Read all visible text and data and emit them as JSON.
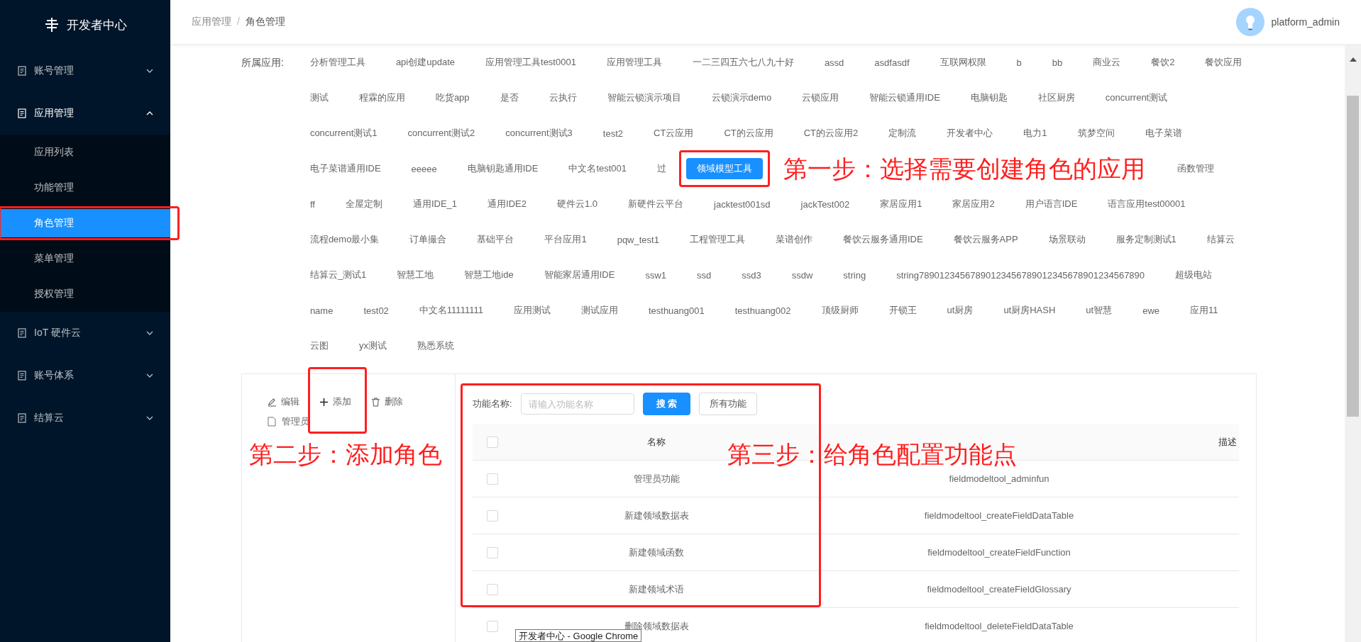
{
  "sidebar": {
    "logo": "开发者中心",
    "items": [
      {
        "label": "账号管理",
        "expanded": false
      },
      {
        "label": "应用管理",
        "expanded": true,
        "children": [
          {
            "label": "应用列表",
            "selected": false,
            "highlighted": false
          },
          {
            "label": "功能管理",
            "selected": false,
            "highlighted": false
          },
          {
            "label": "角色管理",
            "selected": true,
            "highlighted": true
          },
          {
            "label": "菜单管理",
            "selected": false,
            "highlighted": false
          },
          {
            "label": "授权管理",
            "selected": false,
            "highlighted": false
          }
        ]
      },
      {
        "label": "IoT 硬件云",
        "expanded": false
      },
      {
        "label": "账号体系",
        "expanded": false
      },
      {
        "label": "结算云",
        "expanded": false
      }
    ]
  },
  "header": {
    "breadcrumb": [
      "应用管理",
      "角色管理"
    ],
    "separator": "/",
    "user": "platform_admin"
  },
  "apps": {
    "label": "所属应用:",
    "tags": [
      {
        "label": "分析管理工具",
        "selected": false
      },
      {
        "label": "api创建update",
        "selected": false
      },
      {
        "label": "应用管理工具test0001",
        "selected": false
      },
      {
        "label": "应用管理工具",
        "selected": false
      },
      {
        "label": "一二三四五六七八九十好",
        "selected": false
      },
      {
        "label": "assd",
        "selected": false
      },
      {
        "label": "asdfasdf",
        "selected": false
      },
      {
        "label": "互联网权限",
        "selected": false
      },
      {
        "label": "b",
        "selected": false
      },
      {
        "label": "bb",
        "selected": false
      },
      {
        "label": "商业云",
        "selected": false
      },
      {
        "label": "餐饮2",
        "selected": false
      },
      {
        "label": "餐饮应用",
        "selected": false
      },
      {
        "label": "测试",
        "selected": false
      },
      {
        "label": "程霖的应用",
        "selected": false
      },
      {
        "label": "吃货app",
        "selected": false
      },
      {
        "label": "是否",
        "selected": false
      },
      {
        "label": "云执行",
        "selected": false
      },
      {
        "label": "智能云锁演示项目",
        "selected": false
      },
      {
        "label": "云锁演示demo",
        "selected": false
      },
      {
        "label": "云锁应用",
        "selected": false
      },
      {
        "label": "智能云锁通用IDE",
        "selected": false
      },
      {
        "label": "电脑钥匙",
        "selected": false
      },
      {
        "label": "社区厨房",
        "selected": false
      },
      {
        "label": "concurrent测试",
        "selected": false
      },
      {
        "label": "concurrent测试1",
        "selected": false
      },
      {
        "label": "concurrent测试2",
        "selected": false
      },
      {
        "label": "concurrent测试3",
        "selected": false
      },
      {
        "label": "test2",
        "selected": false
      },
      {
        "label": "CT云应用",
        "selected": false
      },
      {
        "label": "CT的云应用",
        "selected": false
      },
      {
        "label": "CT的云应用2",
        "selected": false
      },
      {
        "label": "定制流",
        "selected": false
      },
      {
        "label": "开发者中心",
        "selected": false
      },
      {
        "label": "电力1",
        "selected": false
      },
      {
        "label": "筑梦空间",
        "selected": false
      },
      {
        "label": "电子菜谱",
        "selected": false
      },
      {
        "label": "电子菜谱通用IDE",
        "selected": false
      },
      {
        "label": "eeeee",
        "selected": false
      },
      {
        "label": "电脑钥匙通用IDE",
        "selected": false
      },
      {
        "label": "中文名test001",
        "selected": false
      },
      {
        "label": "过",
        "selected": false
      },
      {
        "label": "领域模型工具",
        "selected": true
      },
      {
        "note": "第一步：选择需要创建角色的应用"
      },
      {
        "label": "函数管理",
        "selected": false
      },
      {
        "label": "ff",
        "selected": false
      },
      {
        "label": "全屋定制",
        "selected": false
      },
      {
        "label": "通用IDE_1",
        "selected": false
      },
      {
        "label": "通用IDE2",
        "selected": false
      },
      {
        "label": "硬件云1.0",
        "selected": false
      },
      {
        "label": "新硬件云平台",
        "selected": false
      },
      {
        "label": "jacktest001sd",
        "selected": false
      },
      {
        "label": "jackTest002",
        "selected": false
      },
      {
        "label": "家居应用1",
        "selected": false
      },
      {
        "label": "家居应用2",
        "selected": false
      },
      {
        "label": "用户语言IDE",
        "selected": false
      },
      {
        "label": "语言应用test00001",
        "selected": false
      },
      {
        "label": "流程demo最小集",
        "selected": false
      },
      {
        "label": "订单撮合",
        "selected": false
      },
      {
        "label": "基础平台",
        "selected": false
      },
      {
        "label": "平台应用1",
        "selected": false
      },
      {
        "label": "pqw_test1",
        "selected": false
      },
      {
        "label": "工程管理工具",
        "selected": false
      },
      {
        "label": "菜谱创作",
        "selected": false
      },
      {
        "label": "餐饮云服务通用IDE",
        "selected": false
      },
      {
        "label": "餐饮云服务APP",
        "selected": false
      },
      {
        "label": "场景联动",
        "selected": false
      },
      {
        "label": "服务定制测试1",
        "selected": false
      },
      {
        "label": "结算云",
        "selected": false
      },
      {
        "label": "结算云_测试1",
        "selected": false
      },
      {
        "label": "智慧工地",
        "selected": false
      },
      {
        "label": "智慧工地ide",
        "selected": false
      },
      {
        "label": "智能家居通用IDE",
        "selected": false
      },
      {
        "label": "ssw1",
        "selected": false
      },
      {
        "label": "ssd",
        "selected": false
      },
      {
        "label": "ssd3",
        "selected": false
      },
      {
        "label": "ssdw",
        "selected": false
      },
      {
        "label": "string",
        "selected": false
      },
      {
        "label": "string78901234567890123456789012345678901234567890",
        "selected": false
      },
      {
        "label": "超级电站",
        "selected": false
      },
      {
        "label": "name",
        "selected": false
      },
      {
        "label": "test02",
        "selected": false
      },
      {
        "label": "中文名11111111",
        "selected": false
      },
      {
        "label": "应用测试",
        "selected": false
      },
      {
        "label": "测试应用",
        "selected": false
      },
      {
        "label": "testhuang001",
        "selected": false
      },
      {
        "label": "testhuang002",
        "selected": false
      },
      {
        "label": "顶级厨师",
        "selected": false
      },
      {
        "label": "开锁王",
        "selected": false
      },
      {
        "label": "ut厨房",
        "selected": false
      },
      {
        "label": "ut厨房HASH",
        "selected": false
      },
      {
        "label": "ut智慧",
        "selected": false
      },
      {
        "label": "ewe",
        "selected": false
      },
      {
        "label": "应用11",
        "selected": false
      },
      {
        "label": "云图",
        "selected": false
      },
      {
        "label": "yx测试",
        "selected": false
      },
      {
        "label": "熟悉系统",
        "selected": false
      }
    ]
  },
  "roles": {
    "toolbar": [
      {
        "label": "编辑",
        "kind": "edit",
        "highlighted": false
      },
      {
        "label": "添加",
        "kind": "add",
        "highlighted": true
      },
      {
        "label": "删除",
        "kind": "delete",
        "highlighted": false
      }
    ],
    "tree": [
      {
        "label": "管理员"
      }
    ],
    "note": "第二步：添加角色"
  },
  "functions": {
    "highlighted": true,
    "note": "第三步：给角色配置功能点",
    "search_label": "功能名称:",
    "search": {
      "placeholder": "请输入功能名称"
    },
    "buttons": [
      {
        "label": "搜 索",
        "kind": "primary"
      },
      {
        "label": "所有功能",
        "kind": "default"
      }
    ],
    "table": {
      "all_checked": false,
      "columns": [
        {
          "label": "名称"
        },
        {},
        {
          "label": "描述"
        }
      ],
      "rows": [
        {
          "name": "管理员功能",
          "key": "fieldmodeltool_adminfun",
          "checked": false
        },
        {
          "name": "新建领域数据表",
          "key": "fieldmodeltool_createFieldDataTable",
          "checked": false
        },
        {
          "name": "新建领域函数",
          "key": "fieldmodeltool_createFieldFunction",
          "checked": false
        },
        {
          "name": "新建领域术语",
          "key": "fieldmodeltool_createFieldGlossary",
          "checked": false
        },
        {
          "name": "删除领域数据表",
          "key": "fieldmodeltool_deleteFieldDataTable",
          "checked": false
        }
      ]
    }
  },
  "tooltip": "开发者中心 - Google Chrome"
}
